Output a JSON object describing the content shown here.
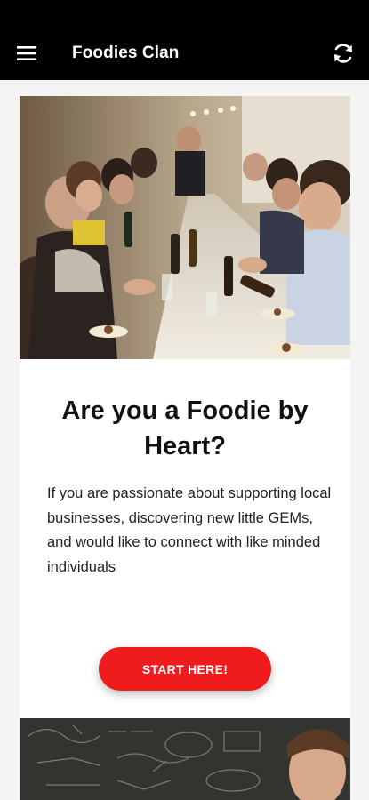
{
  "appbar": {
    "title": "Foodies Clan",
    "menu_icon": "menu-icon",
    "refresh_icon": "refresh-icon"
  },
  "intro_card": {
    "image": "people-dining-at-long-table",
    "heading": "Are you a Foodie by Heart?",
    "body": "If you are passionate about supporting local businesses, discovering new little GEMs, and would like to connect with like minded individuals",
    "cta_label": "START HERE!"
  },
  "next_card": {
    "image": "man-in-front-of-chalkboard"
  },
  "colors": {
    "appbar": "#000000",
    "accent": "#ee1c1c",
    "background": "#f4f4f4"
  }
}
